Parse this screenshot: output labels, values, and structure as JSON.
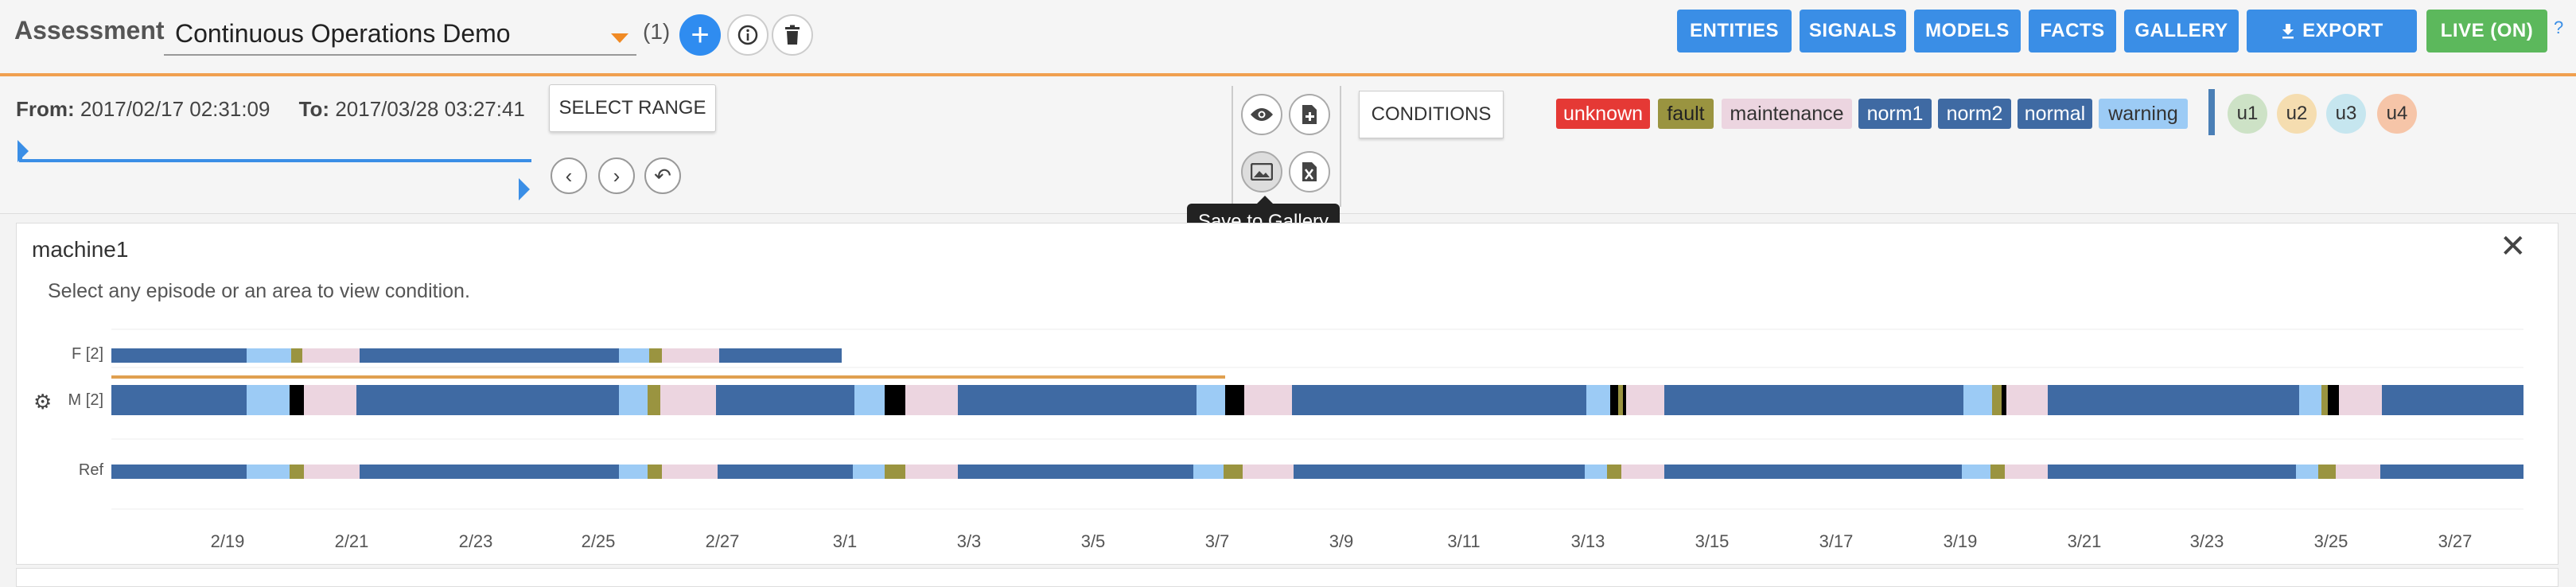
{
  "header": {
    "title": "Assessment",
    "selected": "Continuous Operations Demo",
    "count": "(1)",
    "nav": [
      "ENTITIES",
      "SIGNALS",
      "MODELS",
      "FACTS",
      "GALLERY",
      "EXPORT",
      "LIVE (ON)"
    ],
    "help": "?"
  },
  "range": {
    "from_label": "From:",
    "from": "2017/02/17 02:31:09",
    "to_label": "To:",
    "to": "2017/03/28 03:27:41",
    "select_range": "SELECT RANGE"
  },
  "conditions_button": "CONDITIONS",
  "tags": [
    {
      "label": "unknown",
      "bg": "#e53935",
      "fg": "#ffffff"
    },
    {
      "label": "fault",
      "bg": "#9a9440",
      "fg": "#222222"
    },
    {
      "label": "maintenance",
      "bg": "#ecd5e0",
      "fg": "#333333"
    },
    {
      "label": "norm1",
      "bg": "#3f6aa3",
      "fg": "#ffffff"
    },
    {
      "label": "norm2",
      "bg": "#3f6aa3",
      "fg": "#ffffff"
    },
    {
      "label": "normal",
      "bg": "#3f6aa3",
      "fg": "#ffffff"
    },
    {
      "label": "warning",
      "bg": "#9ccbf5",
      "fg": "#333333"
    }
  ],
  "users": [
    {
      "label": "u1",
      "bg": "#cde2c6"
    },
    {
      "label": "u2",
      "bg": "#f5ddb0"
    },
    {
      "label": "u3",
      "bg": "#c6e6ef"
    },
    {
      "label": "u4",
      "bg": "#f6c5a8"
    }
  ],
  "tooltip": "Save to Gallery",
  "panel": {
    "name": "machine1",
    "hint": "Select any episode or an area to view condition.",
    "rows": [
      "F [2]",
      "M [2]",
      "Ref"
    ],
    "ticks": [
      "2/19",
      "2/21",
      "2/23",
      "2/25",
      "2/27",
      "3/1",
      "3/3",
      "3/5",
      "3/7",
      "3/9",
      "3/11",
      "3/13",
      "3/15",
      "3/17",
      "3/19",
      "3/21",
      "3/23",
      "3/25",
      "3/27"
    ]
  },
  "colors": {
    "accent": "#f0a050",
    "primary": "#3a8ee6",
    "live": "#5cb85c"
  }
}
